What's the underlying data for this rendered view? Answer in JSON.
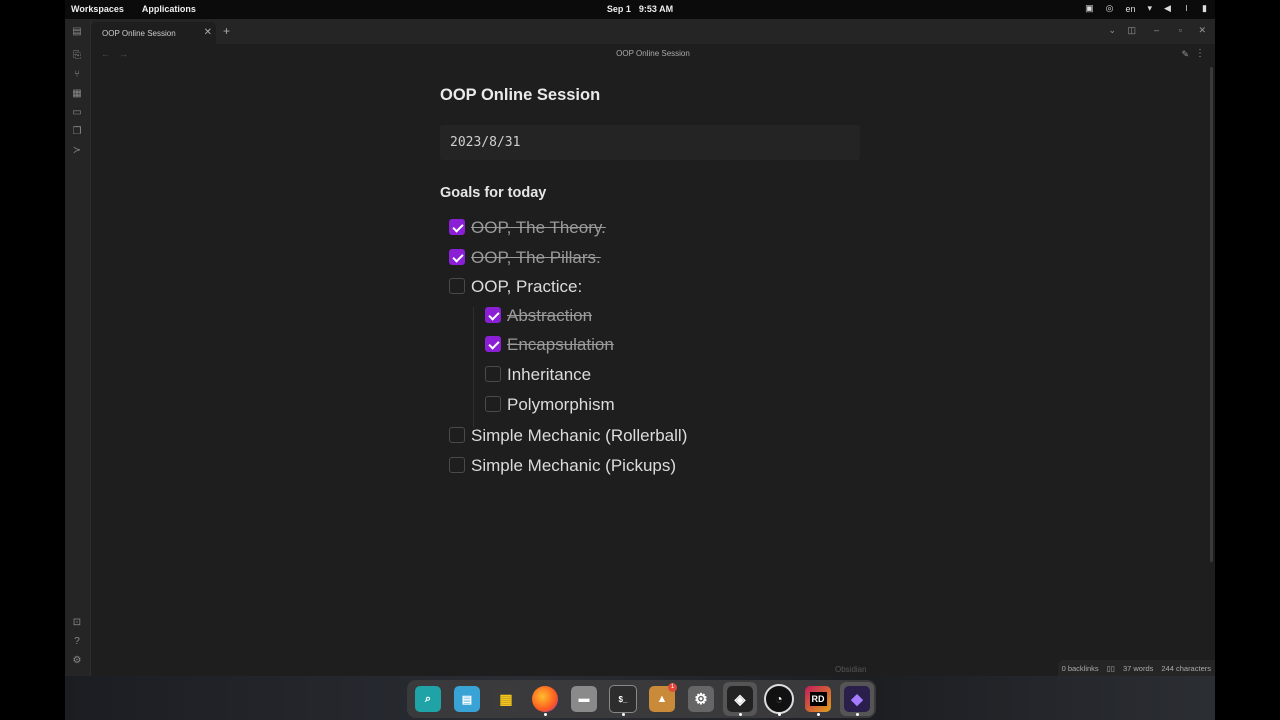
{
  "topbar": {
    "workspaces": "Workspaces",
    "applications": "Applications",
    "date": "Sep 1",
    "time": "9:53 AM",
    "language": "en"
  },
  "tab": {
    "label": "OOP Online Session"
  },
  "header": {
    "title": "OOP Online Session"
  },
  "note": {
    "title": "OOP Online Session",
    "date": "2023/8/31",
    "goals_heading": "Goals for today",
    "tasks": [
      {
        "text": "OOP, The Theory.",
        "checked": true
      },
      {
        "text": "OOP, The Pillars.",
        "checked": true
      },
      {
        "text": "OOP, Practice:",
        "checked": false
      },
      {
        "text": "Abstraction",
        "checked": true
      },
      {
        "text": "Encapsulation",
        "checked": true
      },
      {
        "text": "Inheritance",
        "checked": false
      },
      {
        "text": "Polymorphism",
        "checked": false
      },
      {
        "text": "Simple Mechanic (Rollerball)",
        "checked": false
      },
      {
        "text": "Simple Mechanic (Pickups)",
        "checked": false
      }
    ]
  },
  "statusbar": {
    "backlinks": "0 backlinks",
    "words": "37 words",
    "characters": "244 characters"
  },
  "watermark": "Obsidian",
  "dock": {
    "items": [
      "search",
      "files",
      "apps-grid",
      "firefox",
      "file-manager",
      "terminal",
      "store",
      "settings",
      "unity",
      "obs",
      "rider",
      "obsidian"
    ],
    "rider_label": "RD",
    "store_badge": "1"
  },
  "colors": {
    "accent": "#8a1fd6",
    "background": "#1e1e1e"
  }
}
